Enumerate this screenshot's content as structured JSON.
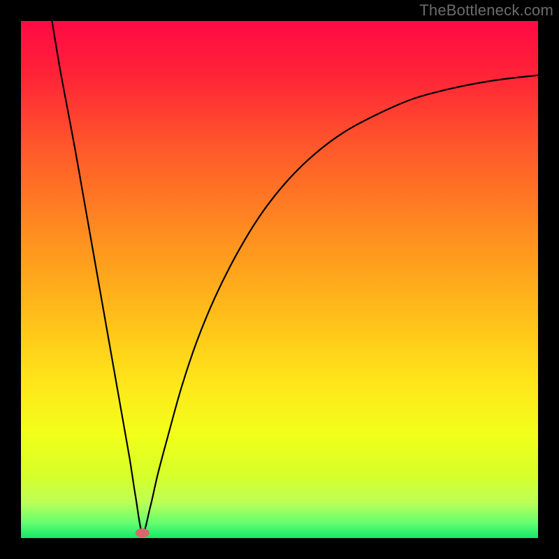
{
  "credit": "TheBottleneck.com",
  "colors": {
    "outer_bg": "#000000",
    "gradient_stops": [
      {
        "offset": "0%",
        "color": "#ff0a44"
      },
      {
        "offset": "10%",
        "color": "#ff2238"
      },
      {
        "offset": "25%",
        "color": "#ff5a2a"
      },
      {
        "offset": "40%",
        "color": "#ff8a20"
      },
      {
        "offset": "55%",
        "color": "#ffb81a"
      },
      {
        "offset": "70%",
        "color": "#ffe61a"
      },
      {
        "offset": "80%",
        "color": "#f2ff1a"
      },
      {
        "offset": "88%",
        "color": "#d6ff2a"
      },
      {
        "offset": "93%",
        "color": "#beff56"
      },
      {
        "offset": "97%",
        "color": "#66ff70"
      },
      {
        "offset": "100%",
        "color": "#14e86a"
      }
    ],
    "curve": "#000000",
    "marker_fill": "#d9666a"
  },
  "chart_data": {
    "type": "line",
    "title": "",
    "xlabel": "",
    "ylabel": "",
    "xlim": [
      0,
      1
    ],
    "ylim": [
      0,
      1
    ],
    "marker": {
      "x": 0.235,
      "y": 0.01
    },
    "series": [
      {
        "name": "bottleneck-curve",
        "points": [
          {
            "x": 0.06,
            "y": 1.0
          },
          {
            "x": 0.075,
            "y": 0.91
          },
          {
            "x": 0.09,
            "y": 0.83
          },
          {
            "x": 0.105,
            "y": 0.75
          },
          {
            "x": 0.12,
            "y": 0.665
          },
          {
            "x": 0.135,
            "y": 0.58
          },
          {
            "x": 0.15,
            "y": 0.495
          },
          {
            "x": 0.165,
            "y": 0.41
          },
          {
            "x": 0.18,
            "y": 0.325
          },
          {
            "x": 0.195,
            "y": 0.24
          },
          {
            "x": 0.21,
            "y": 0.155
          },
          {
            "x": 0.222,
            "y": 0.078
          },
          {
            "x": 0.235,
            "y": 0.01
          },
          {
            "x": 0.25,
            "y": 0.06
          },
          {
            "x": 0.265,
            "y": 0.125
          },
          {
            "x": 0.285,
            "y": 0.2
          },
          {
            "x": 0.31,
            "y": 0.29
          },
          {
            "x": 0.34,
            "y": 0.38
          },
          {
            "x": 0.375,
            "y": 0.465
          },
          {
            "x": 0.415,
            "y": 0.545
          },
          {
            "x": 0.46,
            "y": 0.62
          },
          {
            "x": 0.51,
            "y": 0.685
          },
          {
            "x": 0.565,
            "y": 0.74
          },
          {
            "x": 0.625,
            "y": 0.785
          },
          {
            "x": 0.69,
            "y": 0.82
          },
          {
            "x": 0.76,
            "y": 0.85
          },
          {
            "x": 0.835,
            "y": 0.87
          },
          {
            "x": 0.915,
            "y": 0.885
          },
          {
            "x": 1.0,
            "y": 0.895
          }
        ]
      }
    ]
  }
}
